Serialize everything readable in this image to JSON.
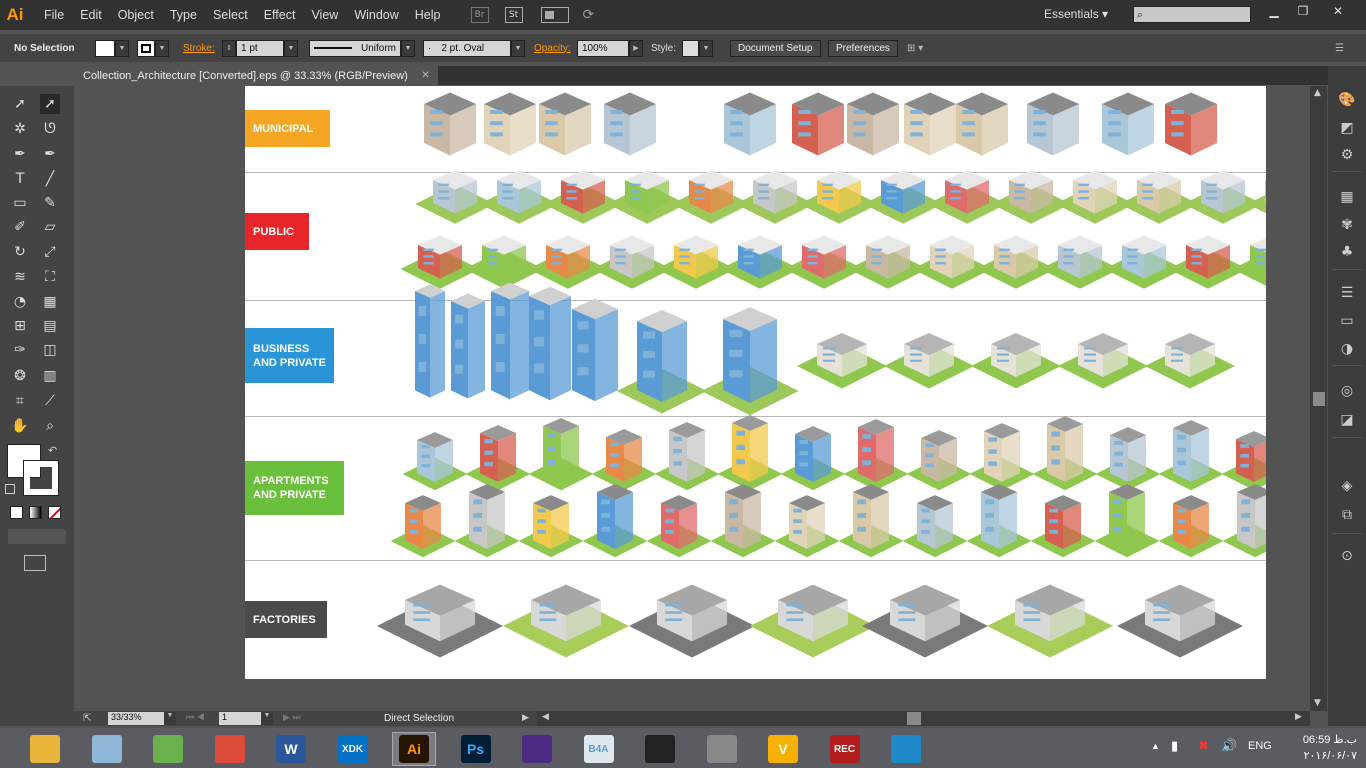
{
  "app": {
    "logo": "Ai",
    "menus": [
      "File",
      "Edit",
      "Object",
      "Type",
      "Select",
      "Effect",
      "View",
      "Window",
      "Help"
    ],
    "bridge": "Br",
    "stock": "St",
    "workspace": "Essentials"
  },
  "control": {
    "selection": "No Selection",
    "stroke_label": "Stroke:",
    "stroke_weight": "1 pt",
    "profile": "Uniform",
    "brush": "2 pt. Oval",
    "opacity_label": "Opacity:",
    "opacity": "100%",
    "style_label": "Style:",
    "doc_setup": "Document Setup",
    "preferences": "Preferences"
  },
  "document": {
    "tab_title": "Collection_Architecture [Converted].eps @ 33.33% (RGB/Preview)",
    "close": "✕"
  },
  "categories": [
    {
      "label": "MUNICIPAL",
      "color": "#f5a623"
    },
    {
      "label": "PUBLIC",
      "color": "#e8262a"
    },
    {
      "label": "BUSINESS\nAND PRIVATE",
      "label1": "BUSINESS",
      "label2": "AND PRIVATE",
      "color": "#2a95d6"
    },
    {
      "label": "APARTMENTS\nAND PRIVATE",
      "label1": "APARTMENTS",
      "label2": "AND PRIVATE",
      "color": "#6abf3c"
    },
    {
      "label": "FACTORIES",
      "color": "#4a4a4a"
    }
  ],
  "status": {
    "zoom": "33/33%",
    "page": "1",
    "tool": "Direct Selection"
  },
  "taskbar": {
    "apps": [
      {
        "name": "file-explorer",
        "label": "",
        "color": "#e8b53a"
      },
      {
        "name": "notepad",
        "label": "",
        "color": "#8fb8d8"
      },
      {
        "name": "bluestacks",
        "label": "",
        "color": "#6ab04c"
      },
      {
        "name": "chrome",
        "label": "",
        "color": "#dd4b39"
      },
      {
        "name": "word",
        "label": "W",
        "color": "#2b579a"
      },
      {
        "name": "intel-xdk",
        "label": "XDK",
        "color": "#0071c5"
      },
      {
        "name": "illustrator",
        "label": "Ai",
        "color": "#261300"
      },
      {
        "name": "photoshop",
        "label": "Ps",
        "color": "#001e36"
      },
      {
        "name": "eclipse",
        "label": "",
        "color": "#4b2c82"
      },
      {
        "name": "b4a",
        "label": "B4A",
        "color": "#dfe7ef"
      },
      {
        "name": "unity",
        "label": "",
        "color": "#222222"
      },
      {
        "name": "settings",
        "label": "",
        "color": "#888888"
      },
      {
        "name": "vegas",
        "label": "V",
        "color": "#f5b000"
      },
      {
        "name": "recorder",
        "label": "REC",
        "color": "#b31c1c"
      },
      {
        "name": "media-player",
        "label": "",
        "color": "#1e88c8"
      }
    ]
  },
  "tray": {
    "lang": "ENG",
    "time": "06:59 ب.ظ",
    "date": "۲۰۱۶/۰۶/۰۷"
  }
}
